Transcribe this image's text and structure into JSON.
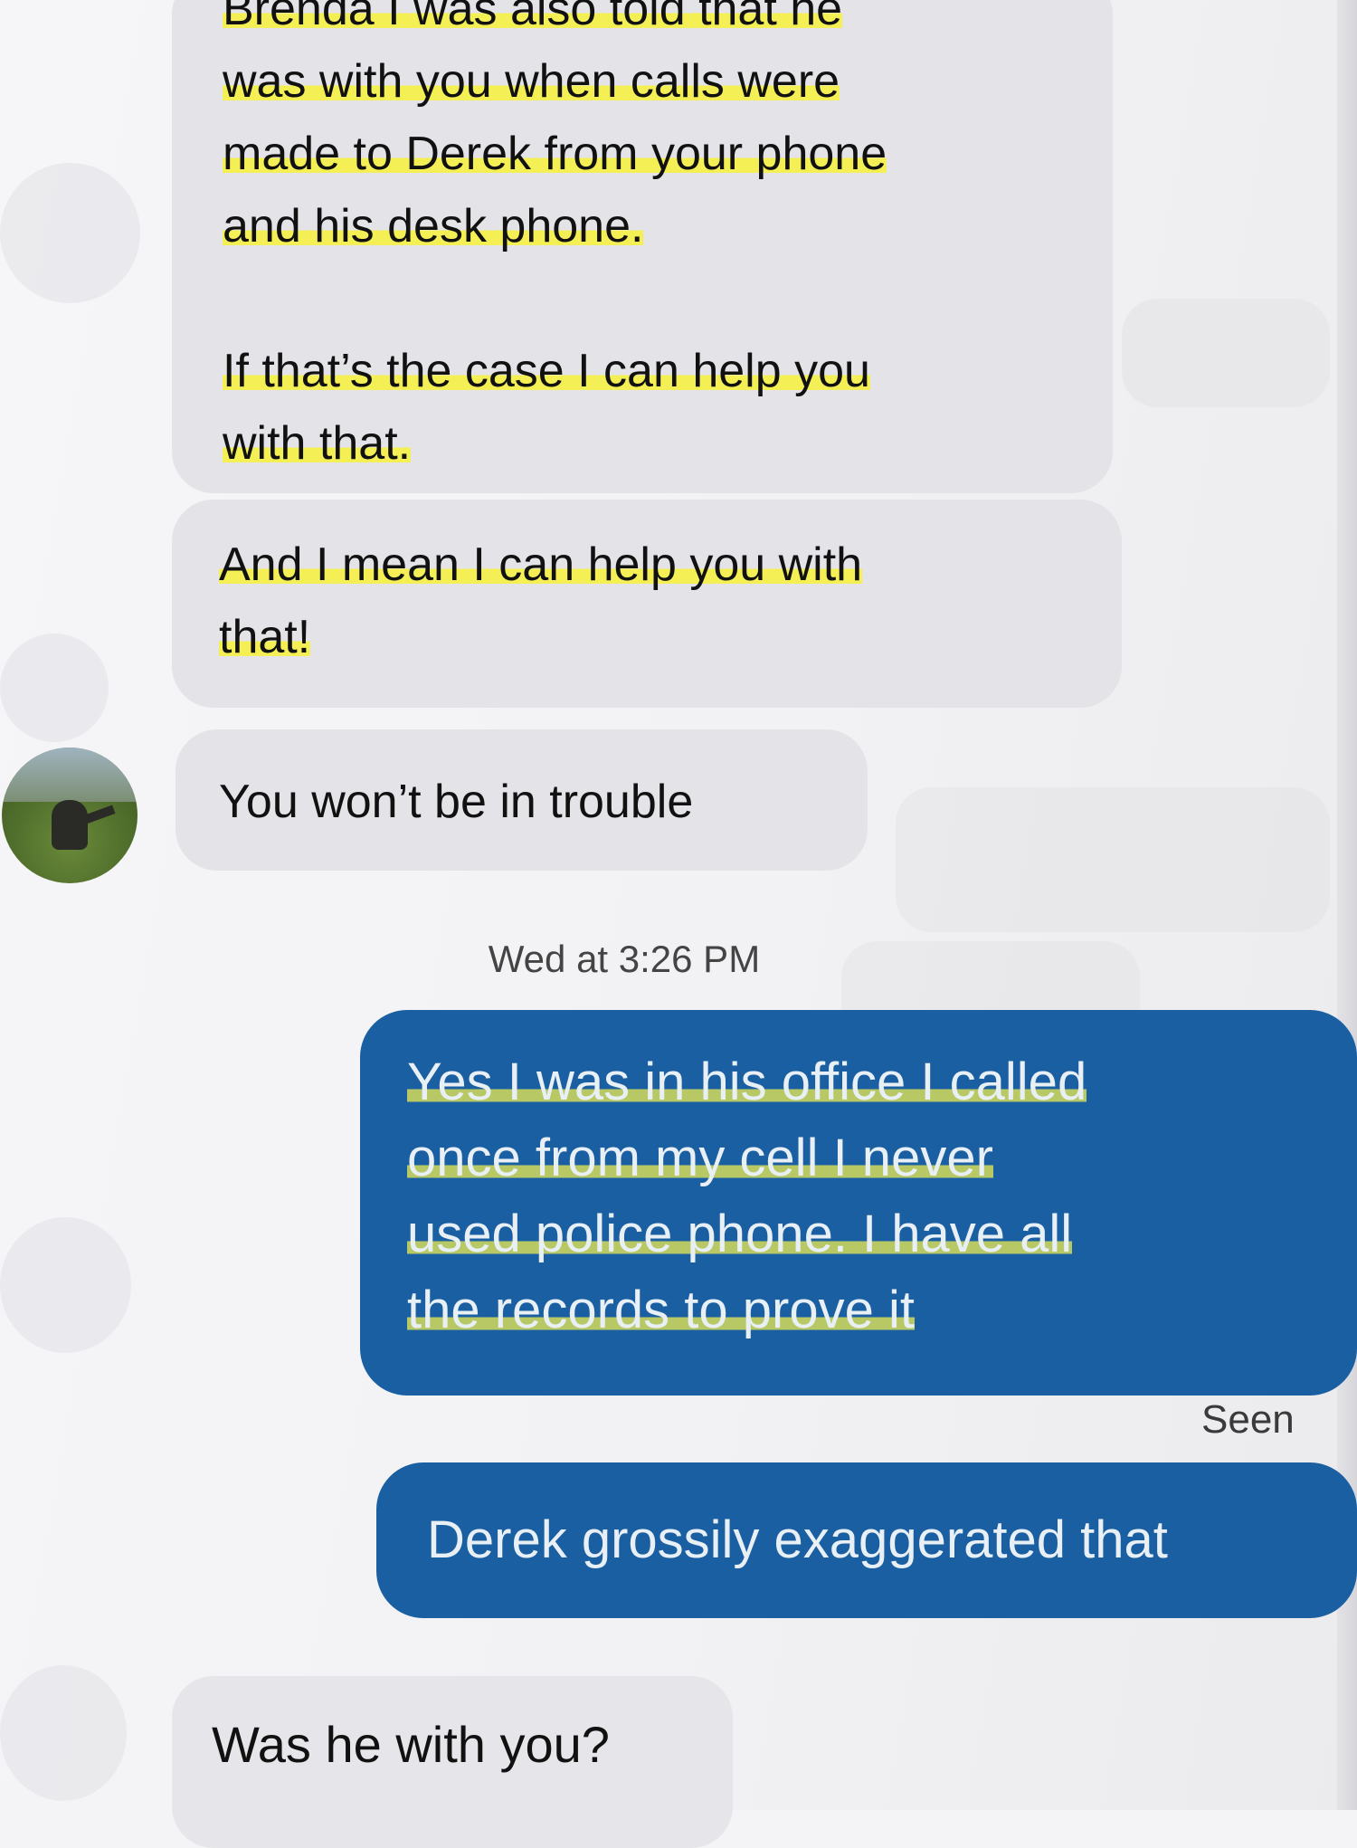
{
  "conversation": {
    "messages": [
      {
        "sender": "other",
        "lines": [
          "Brenda I was also told that he",
          "was with you when calls were",
          "made to Derek from your phone",
          "and his desk phone."
        ],
        "lines2": [
          "If that’s the case I can help you",
          "with that."
        ],
        "highlighted": true
      },
      {
        "sender": "other",
        "lines": [
          "And I mean I can help you with",
          "that!"
        ],
        "highlighted": true
      },
      {
        "sender": "other",
        "lines": [
          "You won’t be in trouble"
        ],
        "highlighted": false
      }
    ],
    "timestamp": "Wed at 3:26 PM",
    "sent": [
      {
        "sender": "me",
        "lines": [
          "Yes I was in his office   I called",
          "once from my cell    I never",
          "used police phone.    I have all",
          "the records to prove it"
        ],
        "highlighted": true
      },
      {
        "sender": "me",
        "lines": [
          "Derek grossily exaggerated that"
        ],
        "highlighted": false
      }
    ],
    "seen_label": "Seen",
    "last_incoming": "Was he with you?"
  },
  "colors": {
    "incoming_bubble": "#e4e4e8",
    "outgoing_bubble": "#1b5fa3",
    "highlight": "#f3ef55"
  }
}
